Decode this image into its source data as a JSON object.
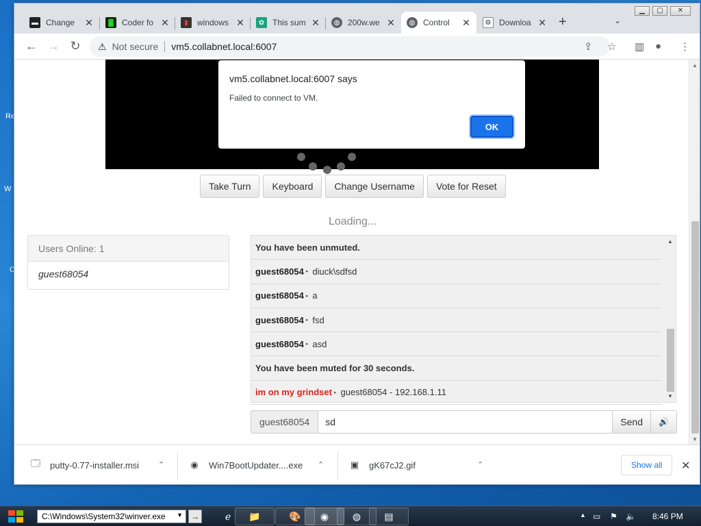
{
  "desktop": {
    "fragments": [
      "Re",
      "W",
      "C"
    ]
  },
  "browser": {
    "tabs": [
      {
        "title": "Change",
        "icon": "terminal-icon",
        "active": false
      },
      {
        "title": "Coder fo",
        "icon": "matrix-icon",
        "active": false
      },
      {
        "title": "windows",
        "icon": "bookmark-icon",
        "active": false
      },
      {
        "title": "This sum",
        "icon": "chatgpt-icon",
        "active": false
      },
      {
        "title": "200w.we",
        "icon": "globe-icon",
        "active": false
      },
      {
        "title": "Control",
        "icon": "globe-icon",
        "active": true
      },
      {
        "title": "Downloa",
        "icon": "puzzle-icon",
        "active": false
      }
    ],
    "security_label": "Not secure",
    "url": "vm5.collabnet.local:6007"
  },
  "vm": {
    "buttons": [
      "Take Turn",
      "Keyboard",
      "Change Username",
      "Vote for Reset"
    ],
    "loading_text": "Loading..."
  },
  "users": {
    "header": "Users Online: 1",
    "list": [
      "guest68054"
    ]
  },
  "chat": {
    "messages": [
      {
        "type": "system",
        "text": "You have been unmuted."
      },
      {
        "type": "user",
        "user": "guest68054",
        "text": "diuck\\sdfsd"
      },
      {
        "type": "user",
        "user": "guest68054",
        "text": "a"
      },
      {
        "type": "user",
        "user": "guest68054",
        "text": "fsd"
      },
      {
        "type": "user",
        "user": "guest68054",
        "text": "asd"
      },
      {
        "type": "system",
        "text": "You have been muted for 30 seconds."
      },
      {
        "type": "admin",
        "user": "im on my grindset",
        "text": "guest68054 - 192.168.1.11"
      }
    ],
    "username_addon": "guest68054",
    "input_value": "sd",
    "send_label": "Send"
  },
  "dialog": {
    "title": "vm5.collabnet.local:6007 says",
    "message": "Failed to connect to VM.",
    "ok_label": "OK"
  },
  "downloads": {
    "items": [
      {
        "name": "putty-0.77-installer.msi",
        "icon": "installer-icon"
      },
      {
        "name": "Win7BootUpdater....exe",
        "icon": "app-icon"
      },
      {
        "name": "gK67cJ2.gif",
        "icon": "image-file-icon"
      }
    ],
    "show_all_label": "Show all"
  },
  "taskbar": {
    "run_value": "C:\\Windows\\System32\\winver.exe",
    "clock": "8:46 PM"
  },
  "colors": {
    "accent": "#1a73e8",
    "admin_name": "#d9231d"
  }
}
